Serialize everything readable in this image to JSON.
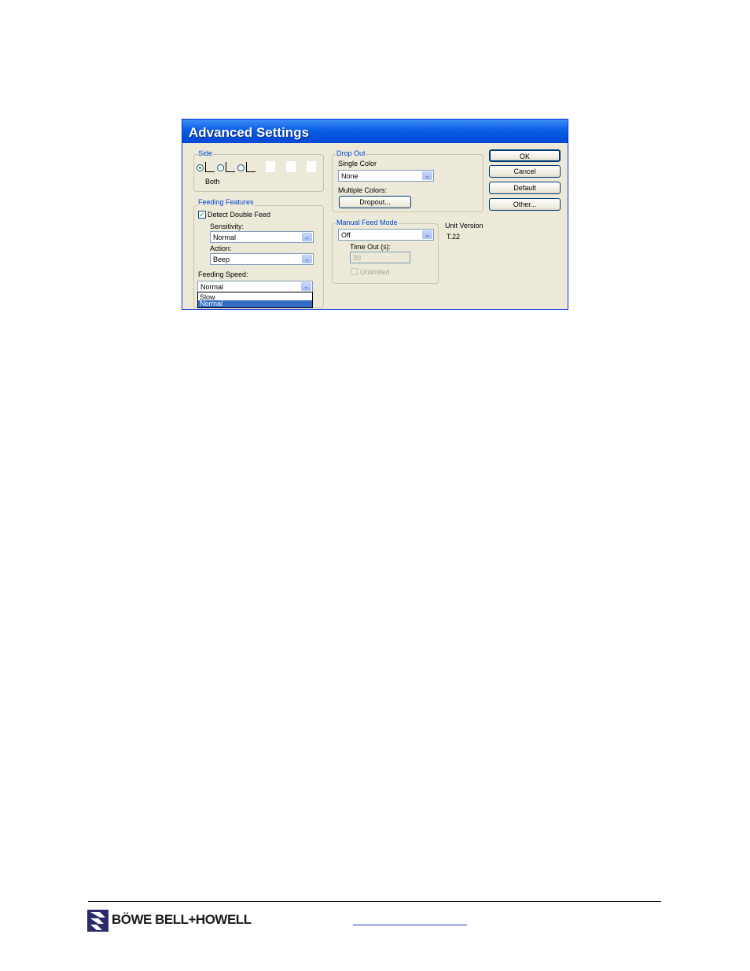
{
  "dialog": {
    "title": "Advanced Settings",
    "side": {
      "legend": "Side",
      "selected_label": "Both"
    },
    "feeding_features": {
      "legend": "Feeding Features",
      "detect_double_feed_label": "Detect Double Feed",
      "detect_double_feed_checked": true,
      "sensitivity_label": "Sensitivity:",
      "sensitivity_value": "Normal",
      "action_label": "Action:",
      "action_value": "Beep"
    },
    "feeding_speed": {
      "label": "Feeding Speed:",
      "value": "Normal",
      "options": [
        "Slow",
        "Normal"
      ],
      "highlighted_option": "Normal"
    },
    "drop_out": {
      "legend": "Drop Out",
      "single_color_label": "Single Color",
      "single_color_value": "None",
      "multiple_colors_label": "Multiple Colors:",
      "dropout_button": "Dropout..."
    },
    "manual_feed_mode": {
      "legend": "Manual Feed Mode",
      "value": "Off",
      "time_out_label": "Time Out (s):",
      "time_out_value": "30",
      "unlimited_label": "Unlimited"
    },
    "unit_version": {
      "label": "Unit Version",
      "value": "T.22"
    },
    "buttons": {
      "ok": "OK",
      "cancel": "Cancel",
      "default": "Default",
      "other": "Other..."
    }
  },
  "footer": {
    "brand": "BÖWE BELL+HOWELL"
  },
  "colors": {
    "titlebar": "#0a5fe6",
    "dialog_bg": "#ece9d8",
    "legend_text": "#0046d5",
    "highlight": "#316ac5"
  }
}
